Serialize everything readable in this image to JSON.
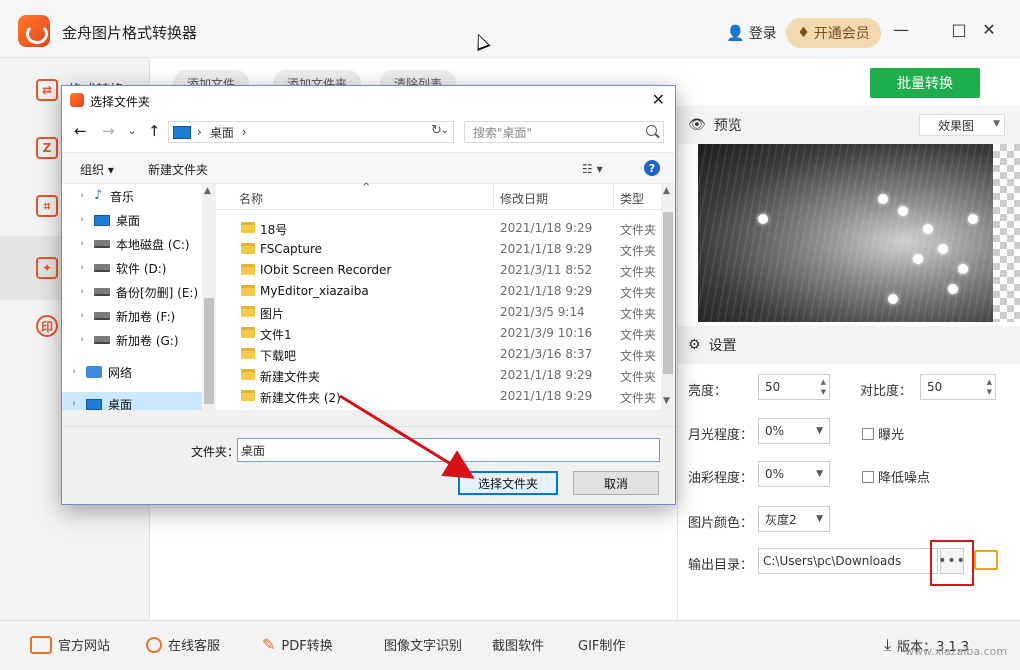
{
  "app": {
    "title": "金舟图片格式转换器",
    "login": "登录",
    "vip": "开通会员",
    "controls": [
      "—",
      "□",
      "✕"
    ]
  },
  "toolbar": {
    "add_file": "添加文件",
    "add_folder": "添加文件夹",
    "clear_list": "清除列表",
    "batch_convert": "批量转换"
  },
  "sidebar": {
    "items": [
      {
        "label": "格式转换",
        "icon": "convert-icon"
      },
      {
        "label": "",
        "icon": "compress-icon"
      },
      {
        "label": "",
        "icon": "crop-icon"
      },
      {
        "label": "",
        "icon": "image-edit-icon"
      },
      {
        "label": "",
        "icon": "watermark-icon"
      }
    ]
  },
  "preview": {
    "title": "预览",
    "effect_select": "效果图"
  },
  "settings": {
    "title": "设置",
    "brightness_label": "亮度：",
    "brightness": "50",
    "contrast_label": "对比度：",
    "contrast": "50",
    "moonlight_label": "月光程度：",
    "moonlight": "0%",
    "exposure_label": "曝光",
    "oil_label": "油彩程度：",
    "oil": "0%",
    "denoise_label": "降低噪点",
    "color_label": "图片颜色：",
    "color": "灰度2",
    "output_label": "输出目录：",
    "output_path": "C:\\Users\\pc\\Downloads",
    "more": "•••"
  },
  "footer": {
    "items": [
      "官方网站",
      "在线客服",
      "PDF转换",
      "图像文字识别",
      "截图软件",
      "GIF制作"
    ],
    "version": "版本：3.1.3",
    "watermark": "www.xiazaiba.com"
  },
  "dialog": {
    "title": "选择文件夹",
    "address": "桌面",
    "search_placeholder": "搜索\"桌面\"",
    "organize": "组织 ▾",
    "new_folder": "新建文件夹",
    "tree": [
      {
        "label": "音乐",
        "icon": "music-icon"
      },
      {
        "label": "桌面",
        "icon": "desktop-icon"
      },
      {
        "label": "本地磁盘 (C:)",
        "icon": "drive-icon"
      },
      {
        "label": "软件 (D:)",
        "icon": "drive-icon"
      },
      {
        "label": "备份[勿删] (E:)",
        "icon": "drive-icon"
      },
      {
        "label": "新加卷 (F:)",
        "icon": "drive-icon"
      },
      {
        "label": "新加卷 (G:)",
        "icon": "drive-icon"
      },
      {
        "label": "网络",
        "icon": "network-icon"
      },
      {
        "label": "桌面",
        "icon": "desktop-icon"
      }
    ],
    "columns": {
      "name": "名称",
      "date": "修改日期",
      "type": "类型"
    },
    "files": [
      {
        "name": "18号",
        "date": "2021/1/18 9:29",
        "type": "文件夹"
      },
      {
        "name": "FSCapture",
        "date": "2021/1/18 9:29",
        "type": "文件夹"
      },
      {
        "name": "IObit Screen Recorder",
        "date": "2021/3/11 8:52",
        "type": "文件夹"
      },
      {
        "name": "MyEditor_xiazaiba",
        "date": "2021/1/18 9:29",
        "type": "文件夹"
      },
      {
        "name": "图片",
        "date": "2021/3/5 9:14",
        "type": "文件夹"
      },
      {
        "name": "文件1",
        "date": "2021/3/9 10:16",
        "type": "文件夹"
      },
      {
        "name": "下载吧",
        "date": "2021/3/16 8:37",
        "type": "文件夹"
      },
      {
        "name": "新建文件夹",
        "date": "2021/1/18 9:29",
        "type": "文件夹"
      },
      {
        "name": "新建文件夹 (2)",
        "date": "2021/1/18 9:29",
        "type": "文件夹"
      }
    ],
    "folder_label": "文件夹：",
    "folder_value": "桌面",
    "ok": "选择文件夹",
    "cancel": "取消"
  },
  "colors": {
    "accent_green": "#1fae4e",
    "brand_orange": "#e8562a",
    "highlight_red": "#e0141d"
  }
}
